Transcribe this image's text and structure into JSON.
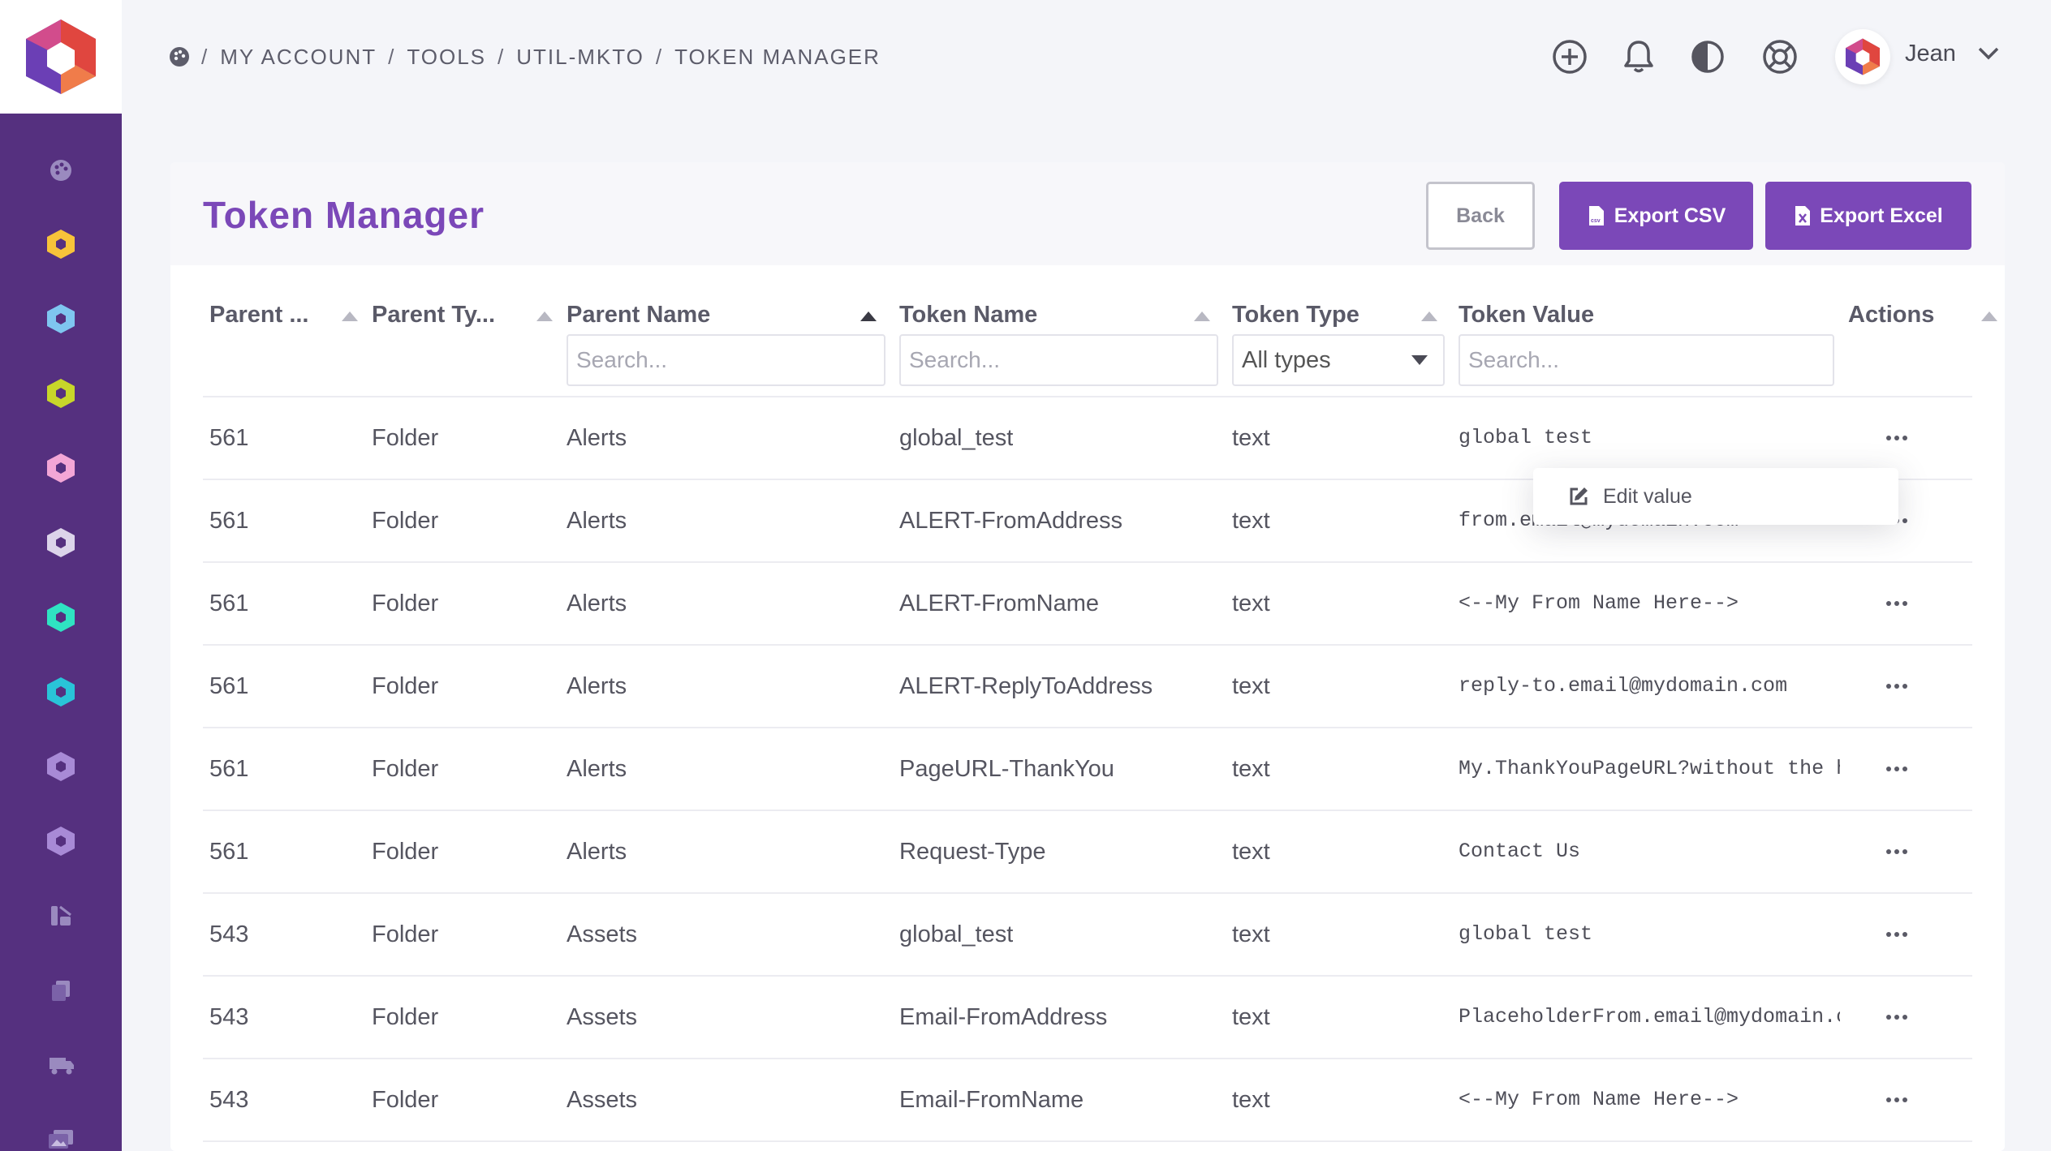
{
  "breadcrumb": {
    "items": [
      "MY ACCOUNT",
      "TOOLS",
      "UTIL-MKTO",
      "TOKEN MANAGER"
    ],
    "separator": "/"
  },
  "user": {
    "name": "Jean"
  },
  "page": {
    "title": "Token Manager",
    "back_label": "Back",
    "export_csv_label": "Export CSV",
    "export_excel_label": "Export Excel"
  },
  "table": {
    "columns": [
      "Parent ...",
      "Parent Ty...",
      "Parent Name",
      "Token Name",
      "Token Type",
      "Token Value",
      "Actions"
    ],
    "filters": {
      "parent_name_placeholder": "Search...",
      "token_name_placeholder": "Search...",
      "token_type_selected": "All types",
      "token_value_placeholder": "Search..."
    },
    "rows": [
      {
        "parent_id": "561",
        "parent_type": "Folder",
        "parent_name": "Alerts",
        "token_name": "global_test",
        "token_type": "text",
        "token_value": "global test"
      },
      {
        "parent_id": "561",
        "parent_type": "Folder",
        "parent_name": "Alerts",
        "token_name": "ALERT-FromAddress",
        "token_type": "text",
        "token_value": "from.email@mydomain.com"
      },
      {
        "parent_id": "561",
        "parent_type": "Folder",
        "parent_name": "Alerts",
        "token_name": "ALERT-FromName",
        "token_type": "text",
        "token_value": "<--My From Name Here-->"
      },
      {
        "parent_id": "561",
        "parent_type": "Folder",
        "parent_name": "Alerts",
        "token_name": "ALERT-ReplyToAddress",
        "token_type": "text",
        "token_value": "reply-to.email@mydomain.com"
      },
      {
        "parent_id": "561",
        "parent_type": "Folder",
        "parent_name": "Alerts",
        "token_name": "PageURL-ThankYou",
        "token_type": "text",
        "token_value": "My.ThankYouPageURL?without the ht"
      },
      {
        "parent_id": "561",
        "parent_type": "Folder",
        "parent_name": "Alerts",
        "token_name": "Request-Type",
        "token_type": "text",
        "token_value": "Contact Us"
      },
      {
        "parent_id": "543",
        "parent_type": "Folder",
        "parent_name": "Assets",
        "token_name": "global_test",
        "token_type": "text",
        "token_value": "global test"
      },
      {
        "parent_id": "543",
        "parent_type": "Folder",
        "parent_name": "Assets",
        "token_name": "Email-FromAddress",
        "token_type": "text",
        "token_value": "PlaceholderFrom.email@mydomain.cc"
      },
      {
        "parent_id": "543",
        "parent_type": "Folder",
        "parent_name": "Assets",
        "token_name": "Email-FromName",
        "token_type": "text",
        "token_value": "<--My From Name Here-->"
      }
    ]
  },
  "popup": {
    "edit_label": "Edit value"
  },
  "colors": {
    "brand": "#7b48b8",
    "sidebar": "#55307f",
    "sidebar_icons": [
      "#f7c33a",
      "#7fc6f0",
      "#c8d62a",
      "#f3a6d6",
      "#dcd4ea",
      "#2fe3c2",
      "#29c4d8",
      "#a88ad6",
      "#a88ad6"
    ]
  },
  "icons": {
    "topbar": [
      "plus-circle-icon",
      "bell-icon",
      "contrast-icon",
      "support-icon"
    ],
    "sidebar_bottom": [
      "tools-icon",
      "copy-icon",
      "truck-icon",
      "images-icon"
    ]
  }
}
